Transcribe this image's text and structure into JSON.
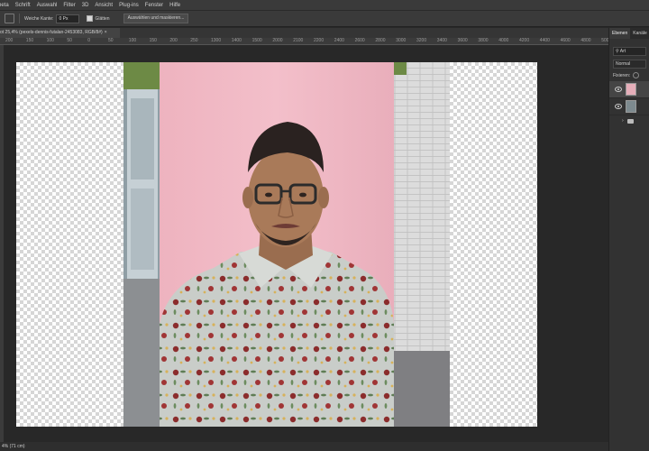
{
  "menubar": {
    "items": [
      "beta",
      "Schrift",
      "Auswahl",
      "Filter",
      "3D",
      "Ansicht",
      "Plug-ins",
      "Fenster",
      "Hilfe"
    ]
  },
  "options": {
    "softedge_label": "Weiche Kante:",
    "softedge_value": "0 Px",
    "smooth_label": "Glätten",
    "select_mask_label": "Auswählen und maskieren..."
  },
  "document": {
    "tab_title": "ot 25,4% (pexels-dennis-futalan-2453083, RGB/8#)",
    "tab_close": "×"
  },
  "ruler": {
    "ticks": [
      "200",
      "150",
      "100",
      "50",
      "0",
      "50",
      "100",
      "150",
      "200",
      "250",
      "1300",
      "1400",
      "1500",
      "2000",
      "2100",
      "2200",
      "2400",
      "2600",
      "2800",
      "3000",
      "3200",
      "3400",
      "3600",
      "3800",
      "4000",
      "4200",
      "4400",
      "4600",
      "4800",
      "5000"
    ]
  },
  "status": {
    "zoom": "4% (71 cm)"
  },
  "panel": {
    "tabs": [
      "Ebenen",
      "Kanäle"
    ],
    "search_label": "Art",
    "blend_mode": "Normal",
    "lock_label": "Fixieren:"
  },
  "colors": {
    "backdrop": "#f0b8c2",
    "shirt": "#c8ccc8",
    "wall": "#e0e0e0"
  }
}
